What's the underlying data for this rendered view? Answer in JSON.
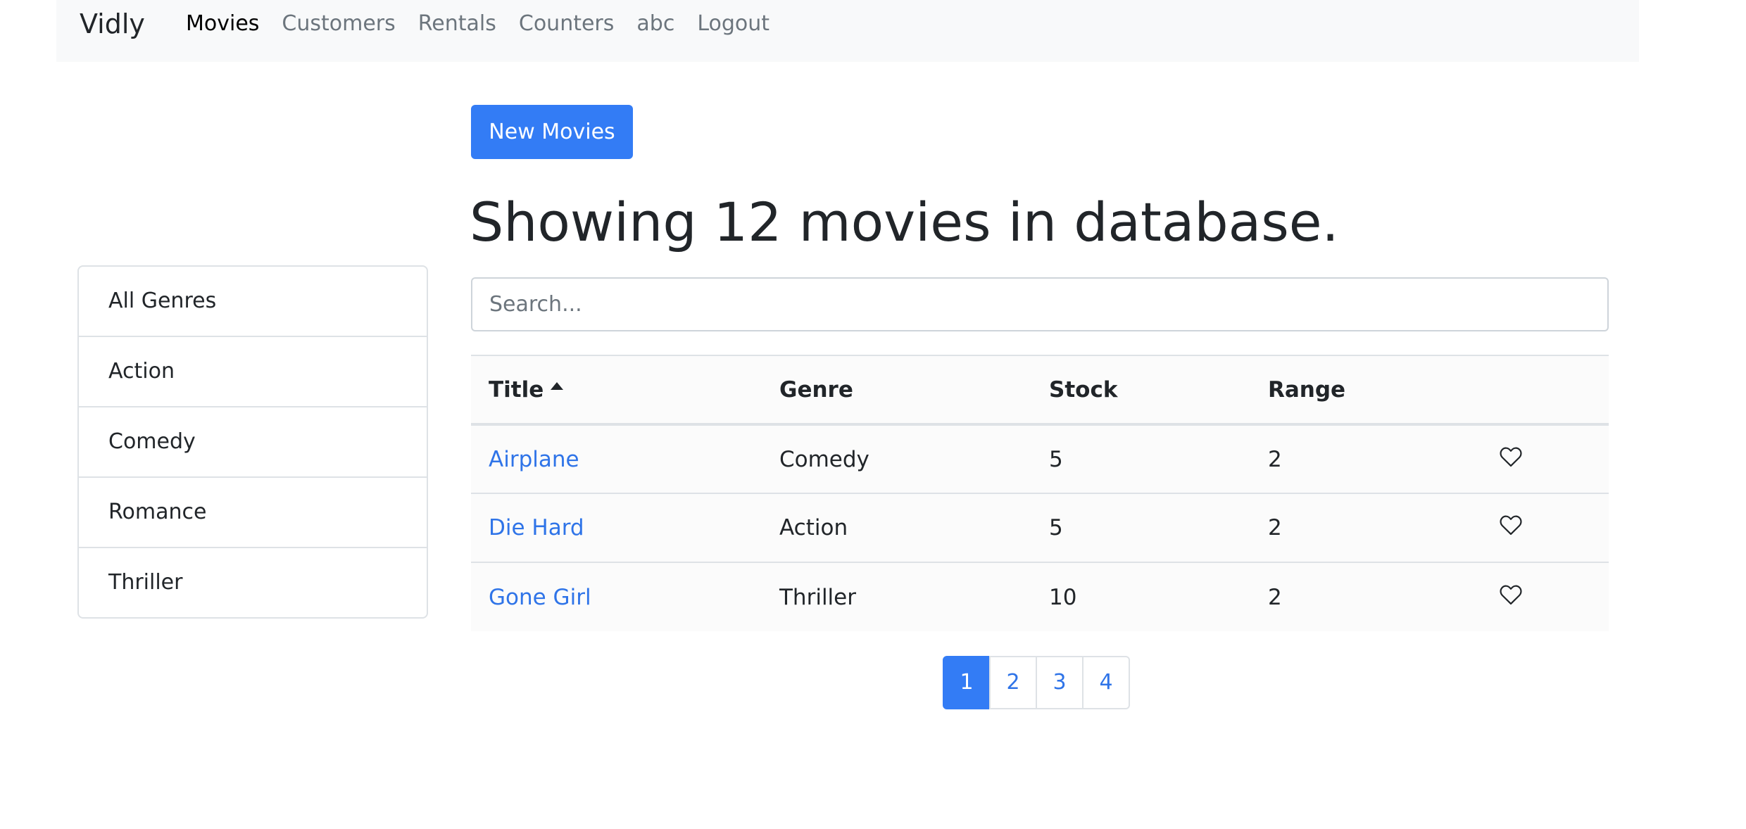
{
  "navbar": {
    "brand": "Vidly",
    "links": [
      {
        "label": "Movies",
        "active": true
      },
      {
        "label": "Customers",
        "active": false
      },
      {
        "label": "Rentals",
        "active": false
      },
      {
        "label": "Counters",
        "active": false
      },
      {
        "label": "abc",
        "active": false
      },
      {
        "label": "Logout",
        "active": false
      }
    ]
  },
  "sidebar": {
    "genres": [
      "All Genres",
      "Action",
      "Comedy",
      "Romance",
      "Thriller"
    ]
  },
  "main": {
    "new_button_label": "New Movies",
    "heading": "Showing 12 movies in database.",
    "search": {
      "placeholder": "Search...",
      "value": ""
    },
    "table": {
      "columns": [
        "Title",
        "Genre",
        "Stock",
        "Range"
      ],
      "sort_icon": "caret-up-icon",
      "like_icon": "heart-outline-icon",
      "rows": [
        {
          "title": "Airplane",
          "genre": "Comedy",
          "stock": "5",
          "range": "2"
        },
        {
          "title": "Die Hard",
          "genre": "Action",
          "stock": "5",
          "range": "2"
        },
        {
          "title": "Gone Girl",
          "genre": "Thriller",
          "stock": "10",
          "range": "2"
        }
      ]
    },
    "pagination": {
      "pages": [
        "1",
        "2",
        "3",
        "4"
      ],
      "current": "1"
    }
  },
  "colors": {
    "primary": "#337cf5",
    "link": "#2f74e8",
    "navbar_bg": "#f8f9fa",
    "border": "#dee2e6"
  }
}
